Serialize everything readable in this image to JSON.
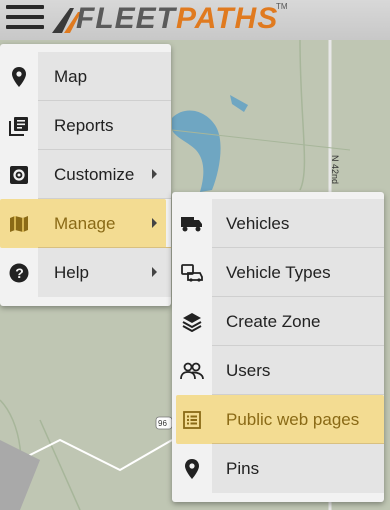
{
  "header": {
    "logo_text_fleet": "FLEET",
    "logo_text_paths": "PATHS",
    "trademark": "TM"
  },
  "map": {
    "road_label": "N 42nd",
    "route_label": "96"
  },
  "main_menu": {
    "items": [
      {
        "label": "Map",
        "icon": "map-pin-icon"
      },
      {
        "label": "Reports",
        "icon": "reports-icon"
      },
      {
        "label": "Customize",
        "icon": "gear-icon",
        "has_submenu": true
      },
      {
        "label": "Manage",
        "icon": "map-icon",
        "has_submenu": true,
        "highlighted": true
      },
      {
        "label": "Help",
        "icon": "help-icon",
        "has_submenu": true
      }
    ]
  },
  "manage_submenu": {
    "items": [
      {
        "label": "Vehicles",
        "icon": "truck-icon"
      },
      {
        "label": "Vehicle Types",
        "icon": "vehicle-types-icon"
      },
      {
        "label": "Create Zone",
        "icon": "layers-icon"
      },
      {
        "label": "Users",
        "icon": "users-icon"
      },
      {
        "label": "Public web pages",
        "icon": "list-page-icon",
        "highlighted": true
      },
      {
        "label": "Pins",
        "icon": "map-pin-icon"
      }
    ]
  },
  "colors": {
    "highlight": "#f4d36a",
    "brand_orange": "#e07a1f",
    "map_land": "#bfc6b3",
    "map_water": "#6fa6c2"
  }
}
